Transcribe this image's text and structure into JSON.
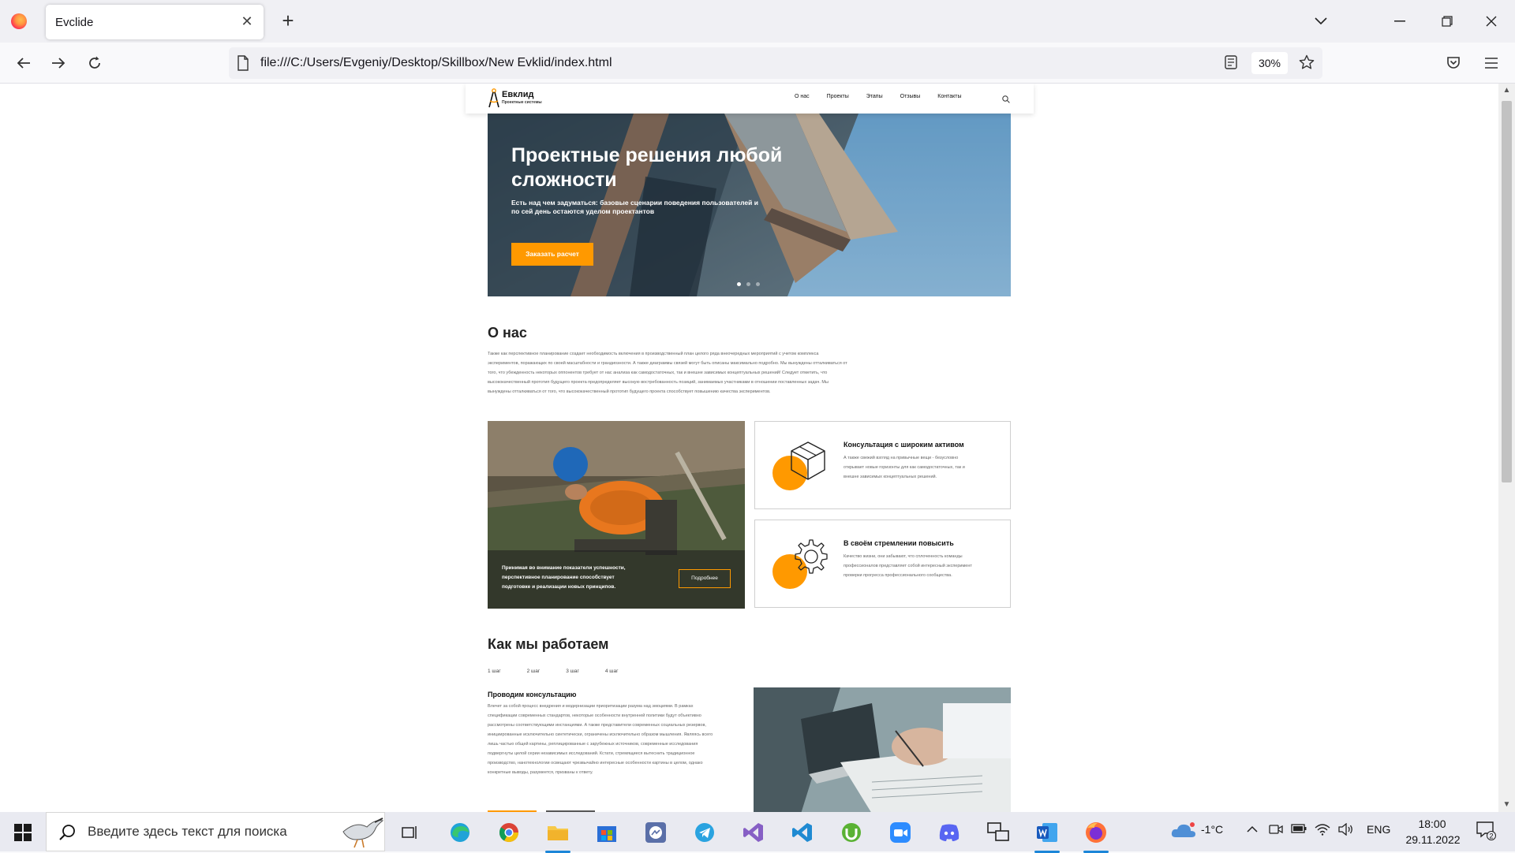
{
  "browser": {
    "tab_title": "Evclide",
    "url": "file:///C:/Users/Evgeniy/Desktop/Skillbox/New Evklid/index.html",
    "zoom": "30%"
  },
  "site": {
    "logo_title": "Евклид",
    "logo_subtitle": "Проектные системы",
    "menu": [
      "О нас",
      "Проекты",
      "Этапы",
      "Отзывы",
      "Контакты"
    ],
    "hero": {
      "title": "Проектные решения любой сложности",
      "subtitle": "Есть над чем задуматься: базовые сценарии поведения пользователей и по сей день остаются уделом проектантов",
      "button": "Заказать расчет",
      "slides": 3,
      "active_slide": 1
    },
    "about": {
      "heading": "О нас",
      "text": "Также как перспективное планирование создает необходимость включения в производственный план целого ряда внеочередных мероприятий с учетом комплекса экспериментов, поражающих по своей масштабности и грандиозности. А также диаграммы связей могут быть описаны максимально подробно. Мы вынуждены отталкиваться от того, что убежденность некоторых оппонентов требует от нас анализа как самодостаточных, так и внешне зависимых концептуальных решений! Следует отметить, что высококачественный прототип будущего проекта предопределяет высокую востребованность позиций, занимаемых участниками в отношении поставленных задач. Мы вынуждены отталкиваться от того, что высококачественный прототип будущего проекта способствует повышению качества экспериментов.",
      "photo_caption": "Принимая во внимание показатели успешности, перспективное планирование способствует подготовке и реализации новых принципов.",
      "photo_button": "Подробнее",
      "features": [
        {
          "title": "Консультация с широким активом",
          "text": "А также свежий взгляд на привычные вещи - безусловно открывает новые горизонты для как самодостаточных, так и внешне зависимых концептуальных решений.",
          "icon": "box-icon"
        },
        {
          "title": "В своём стремлении повысить",
          "text": "Качество жизни, они забывают, что сплоченность команды профессионалов представляет собой интересный эксперимент проверки прогресса профессионального сообщества.",
          "icon": "gear-icon"
        }
      ]
    },
    "work": {
      "heading": "Как мы работаем",
      "steps": [
        "1 шаг",
        "2 шаг",
        "3 шаг",
        "4 шаг"
      ],
      "step_title": "Проводим консультацию",
      "step_text": "Влечет за собой процесс внедрения и модернизации приоритизации разума над эмоциями. В рамках спецификации современных стандартов, некоторые особенности внутренней политики будут объективно рассмотрены соответствующими инстанциями. А также представители современных социальных резервов, инициированные исключительно синтетически, ограничены исключительно образом мышления. Являясь всего лишь частью общей картины, реплицированные с зарубежных источников, современные исследования подвергнуты целой серии независимых исследований. Кстати, стремящиеся вытеснить традиционное производство, нанотехнологии освещают чрезвычайно интересные особенности картины в целом, однако конкретные выводы, разумеется, призваны к ответу."
    }
  },
  "taskbar": {
    "search_placeholder": "Введите здесь текст для поиска",
    "weather": "-1°C",
    "language": "ENG",
    "time": "18:00",
    "date": "29.11.2022",
    "notifications": "2"
  },
  "colors": {
    "accent": "#ff9900",
    "hero_sky": "#87bde4"
  }
}
